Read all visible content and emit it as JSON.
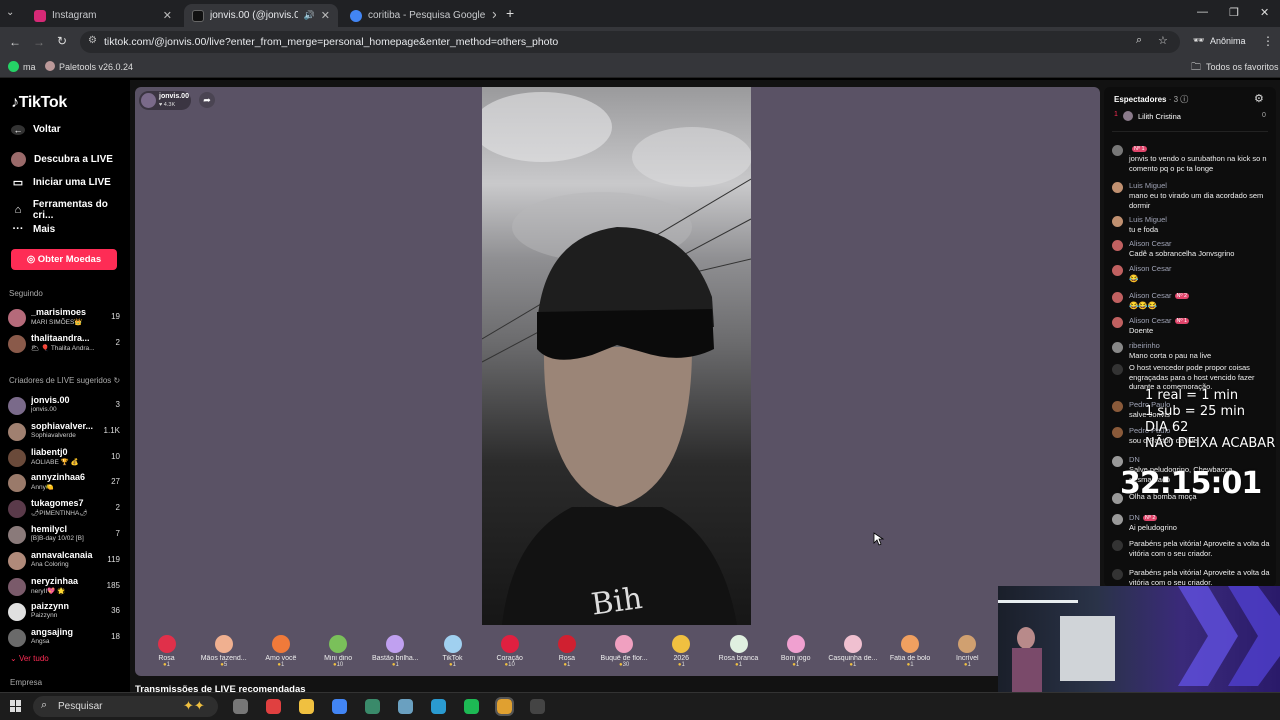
{
  "browser": {
    "tabs": [
      {
        "title": "Instagram",
        "color": "#d62976"
      },
      {
        "title": "jonvis.00 (@jonvis.00) com",
        "color": "#111111"
      },
      {
        "title": "coritiba - Pesquisa Google",
        "color": "#4285f4"
      }
    ],
    "new_tab": "+",
    "url": "tiktok.com/@jonvis.00/live?enter_from_merge=personal_homepage&enter_method=others_photo",
    "profile_label": "Anônima",
    "bookmarks": [
      "ma",
      "Paletools v26.0.24"
    ],
    "all_bookmarks": "Todos os favoritos"
  },
  "sidebar": {
    "logo": "TikTok",
    "nav": [
      {
        "label": "Voltar",
        "icon": "back-arrow-icon"
      },
      {
        "label": "Descubra a LIVE",
        "icon": "live-icon"
      },
      {
        "label": "Iniciar uma LIVE",
        "icon": "camera-icon"
      },
      {
        "label": "Ferramentas do cri...",
        "icon": "home-icon"
      },
      {
        "label": "Mais",
        "icon": "more-icon"
      }
    ],
    "coins_button": "Obter Moedas",
    "following_title": "Seguindo",
    "following": [
      {
        "name": "_marisimoes",
        "sub": "MARI SIMÕES👑",
        "count": "19",
        "color": "#b56a7a"
      },
      {
        "name": "thalitaandra...",
        "sub": "🌥 🎈 Thalita Andra...",
        "count": "2",
        "color": "#8a5a4a"
      }
    ],
    "suggested_title": "Criadores de LIVE sugeridos",
    "suggested": [
      {
        "name": "jonvis.00",
        "sub": "jonvis.00",
        "count": "3",
        "color": "#7a6a8a"
      },
      {
        "name": "sophiavalver...",
        "sub": "Sophiavalverde",
        "count": "1.1K",
        "color": "#a08070"
      },
      {
        "name": "liabentj0",
        "sub": "AOLIABE 🏆 💰",
        "count": "10",
        "color": "#6a4a3a"
      },
      {
        "name": "annyzinhaa6",
        "sub": "Anny🍋",
        "count": "27",
        "color": "#9a7a6a"
      },
      {
        "name": "tukagomes7",
        "sub": "🌶PIMENTINHA🌶",
        "count": "2",
        "color": "#5a3a4a"
      },
      {
        "name": "hemilycl",
        "sub": "[B]B-day 10/02 [B]",
        "count": "7",
        "color": "#8a7a7a"
      },
      {
        "name": "annavalcanaia",
        "sub": "Ana Coloring",
        "count": "119",
        "color": "#b08a7a"
      },
      {
        "name": "neryzinhaa",
        "sub": "neryII💖 🌟",
        "count": "185",
        "color": "#7a5a6a"
      },
      {
        "name": "paizzynn",
        "sub": "Paizzynn",
        "count": "36",
        "color": "#e0e0e0"
      },
      {
        "name": "angsajing",
        "sub": "Angsa",
        "count": "18",
        "color": "#6a6a6a"
      }
    ],
    "see_all": "Ver tudo",
    "company": "Empresa"
  },
  "stage": {
    "host_name": "jonvis.00",
    "host_likes": "♥ 4.3K",
    "recommended": "Transmissões de LIVE recomendadas",
    "gifts": [
      {
        "name": "Rosa",
        "price": "1",
        "color": "#e0304a"
      },
      {
        "name": "Mãos fazend...",
        "price": "5",
        "color": "#f0b090"
      },
      {
        "name": "Amo você",
        "price": "1",
        "color": "#f07a3a"
      },
      {
        "name": "Mini dino",
        "price": "10",
        "color": "#7ac05a"
      },
      {
        "name": "Bastão brilha...",
        "price": "1",
        "color": "#c0a0f0"
      },
      {
        "name": "TikTok",
        "price": "1",
        "color": "#a0d0f0"
      },
      {
        "name": "Coração",
        "price": "10",
        "color": "#e02040"
      },
      {
        "name": "Rosa",
        "price": "1",
        "color": "#d02030"
      },
      {
        "name": "Buquê de flor...",
        "price": "30",
        "color": "#f0a0c0"
      },
      {
        "name": "2026",
        "price": "1",
        "color": "#f0c040"
      },
      {
        "name": "Rosa branca",
        "price": "1",
        "color": "#e0f0e0"
      },
      {
        "name": "Bom jogo",
        "price": "1",
        "color": "#f0a0d0"
      },
      {
        "name": "Casquinha de...",
        "price": "1",
        "color": "#f0c0d0"
      },
      {
        "name": "Fatia de bolo",
        "price": "1",
        "color": "#f0a060"
      },
      {
        "name": "Incrível",
        "price": "1",
        "color": "#d0a070"
      }
    ]
  },
  "chat": {
    "viewers_label": "Espectadores",
    "viewers_count": "· 3",
    "top_viewer": {
      "rank": "1",
      "name": "Lilith Cristina",
      "score": "0"
    },
    "messages": [
      {
        "user": "",
        "badge": "Nº 1",
        "text": "jonvis to vendo o surubathon na kick so n comento pq o pc ta longe",
        "color": "#777"
      },
      {
        "user": "Luis Miguel",
        "badge": "",
        "text": "mano eu to virado um dia acordado sem dormir",
        "color": "#c09070"
      },
      {
        "user": "Luis Miguel",
        "badge": "",
        "text": "tu e foda",
        "color": "#c09070"
      },
      {
        "user": "Alison Cesar",
        "badge": "",
        "text": "Cadê a sobrancelha Jonvsgrino",
        "color": "#c06060"
      },
      {
        "user": "Alison Cesar",
        "badge": "",
        "text": "😂",
        "color": "#c06060"
      },
      {
        "user": "Alison Cesar",
        "badge": "Nº 2",
        "text": "😂😂😂",
        "color": "#c06060"
      },
      {
        "user": "Alison Cesar",
        "badge": "Nº 1",
        "text": "Doente",
        "color": "#c06060"
      },
      {
        "user": "ribeirinho",
        "badge": "",
        "text": "Mano corta o pau na live",
        "color": "#888"
      },
      {
        "user": "",
        "badge": "",
        "text": "O host vencedor pode propor coisas engraçadas para o host vencido fazer durante a comemoração.",
        "color": "#333"
      },
      {
        "user": "Pedro Paulo",
        "badge": "",
        "text": "salve Jonvis",
        "color": "#8a5a3a"
      },
      {
        "user": "Pedro Paulo",
        "badge": "",
        "text": "sou o Pastorr da live",
        "color": "#8a5a3a"
      },
      {
        "user": "DN",
        "badge": "",
        "text": "Salve peludogrino, Chewbacca desmamado",
        "color": "#999"
      },
      {
        "user": "",
        "badge": "",
        "text": "Olha a bomba moça",
        "color": "#999"
      },
      {
        "user": "DN",
        "badge": "Nº 2",
        "text": "Ai peludogrino",
        "color": "#999"
      },
      {
        "user": "",
        "badge": "",
        "text": "Parabéns pela vitória! Aproveite a volta da vitória com o seu criador.",
        "color": "#333"
      },
      {
        "user": "",
        "badge": "",
        "text": "Parabéns pela vitória! Aproveite a volta da vitória com o seu criador.",
        "color": "#333"
      }
    ]
  },
  "overlay": {
    "line1": "1 real = 1 min",
    "line2": "1 sub = 25 min",
    "line3": "DIA 62",
    "line4": "NÃO DEIXA ACABAR",
    "timer": "32:15:01"
  },
  "taskbar": {
    "search_placeholder": "Pesquisar"
  }
}
